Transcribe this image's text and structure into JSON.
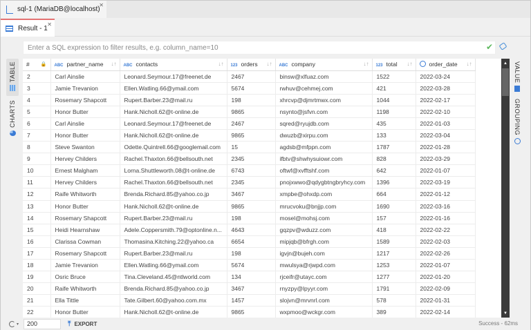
{
  "window_tab": {
    "title": "sql-1 (MariaDB@localhost)",
    "icon": "script-icon"
  },
  "result_tab": {
    "title": "Result - 1",
    "icon": "table-icon"
  },
  "filter": {
    "placeholder": "Enter a SQL expression to filter results, e.g. column_name=10",
    "value": ""
  },
  "left_panel": {
    "table": "TABLE",
    "charts": "CHARTS"
  },
  "right_panel": {
    "value": "VALUE",
    "grouping": "GROUPING"
  },
  "columns": [
    {
      "name": "#",
      "type": ""
    },
    {
      "name": "partner_name",
      "type": "ABC"
    },
    {
      "name": "contacts",
      "type": "ABC"
    },
    {
      "name": "orders",
      "type": "123"
    },
    {
      "name": "company",
      "type": "ABC"
    },
    {
      "name": "total",
      "type": "123"
    },
    {
      "name": "order_date",
      "type": "date"
    }
  ],
  "rows": [
    [
      "2",
      "Carl Ainslie",
      "Leonard.Seymour.17@freenet.de",
      "2467",
      "binsw@xlfuaz.com",
      "1522",
      "2022-03-24"
    ],
    [
      "3",
      "Jamie Trevanion",
      "Ellen.Watling.66@ymail.com",
      "5674",
      "rwhuv@cehmej.com",
      "421",
      "2022-03-28"
    ],
    [
      "4",
      "Rosemary Shapcott",
      "Rupert.Barber.23@mail.ru",
      "198",
      "xhrcvp@djmrtmwx.com",
      "1044",
      "2022-02-17"
    ],
    [
      "5",
      "Honor Butter",
      "Hank.Nicholl.62@t-online.de",
      "9865",
      "nsynto@jsfvn.com",
      "1198",
      "2022-02-10"
    ],
    [
      "6",
      "Carl Ainslie",
      "Leonard.Seymour.17@freenet.de",
      "2467",
      "sqred@ryujdb.com",
      "435",
      "2022-01-03"
    ],
    [
      "7",
      "Honor Butter",
      "Hank.Nicholl.62@t-online.de",
      "9865",
      "dwuzb@xirpu.com",
      "133",
      "2022-03-04"
    ],
    [
      "8",
      "Steve Swanton",
      "Odette.Quintrell.66@googlemail.com",
      "15",
      "agdsb@mfppn.com",
      "1787",
      "2022-01-28"
    ],
    [
      "9",
      "Hervey Childers",
      "Rachel.Thaxton.66@bellsouth.net",
      "2345",
      "ifbtv@shwhysuiowr.com",
      "828",
      "2022-03-29"
    ],
    [
      "10",
      "Ernest Malgham",
      "Lorna.Shuttleworth.08@t-online.de",
      "6743",
      "oftwf@xvfftshf.com",
      "642",
      "2022-01-07"
    ],
    [
      "11",
      "Hervey Childers",
      "Rachel.Thaxton.66@bellsouth.net",
      "2345",
      "pnojxwwo@qdygbtngbryhcy.com",
      "1396",
      "2022-03-19"
    ],
    [
      "12",
      "Raife Whitworth",
      "Brenda.Richard.85@yahoo.co.jp",
      "3467",
      "xmpbe@ohxdp.com",
      "664",
      "2022-01-12"
    ],
    [
      "13",
      "Honor Butter",
      "Hank.Nicholl.62@t-online.de",
      "9865",
      "mrucvoku@bnjjp.com",
      "1690",
      "2022-03-16"
    ],
    [
      "14",
      "Rosemary Shapcott",
      "Rupert.Barber.23@mail.ru",
      "198",
      "mosel@mohsj.com",
      "157",
      "2022-01-16"
    ],
    [
      "15",
      "Heidi Hearnshaw",
      "Adele.Coppersmith.79@optonline.n...",
      "4643",
      "gqzpv@wduzz.com",
      "418",
      "2022-02-22"
    ],
    [
      "16",
      "Clarissa Cowman",
      "Thomasina.Kitching.22@yahoo.ca",
      "6654",
      "mipjqb@bfrgh.com",
      "1589",
      "2022-02-03"
    ],
    [
      "17",
      "Rosemary Shapcott",
      "Rupert.Barber.23@mail.ru",
      "198",
      "igvjn@bujeh.com",
      "1217",
      "2022-02-26"
    ],
    [
      "18",
      "Jamie Trevanion",
      "Ellen.Watling.66@ymail.com",
      "5674",
      "mwulsya@rjwpd.com",
      "1253",
      "2022-01-07"
    ],
    [
      "19",
      "Osric Bruce",
      "Tina.Cleveland.45@ntlworld.com",
      "134",
      "rjceifr@utayc.com",
      "1277",
      "2022-01-20"
    ],
    [
      "20",
      "Raife Whitworth",
      "Brenda.Richard.85@yahoo.co.jp",
      "3467",
      "rnyzpy@lpyyr.com",
      "1791",
      "2022-02-09"
    ],
    [
      "21",
      "Ella Tittle",
      "Tate.Gilbert.60@yahoo.com.mx",
      "1457",
      "slojvn@mrvnrl.com",
      "578",
      "2022-01-31"
    ],
    [
      "22",
      "Honor Butter",
      "Hank.Nicholl.62@t-online.de",
      "9865",
      "wxpmoo@wckgr.com",
      "389",
      "2022-02-14"
    ]
  ],
  "bottom": {
    "limit": "200",
    "export": "EXPORT",
    "status": "Success - 62ms"
  },
  "colors": {
    "accent": "#3a7bd5",
    "active_tab_border": "#e57373",
    "ok": "#5cb85c"
  }
}
